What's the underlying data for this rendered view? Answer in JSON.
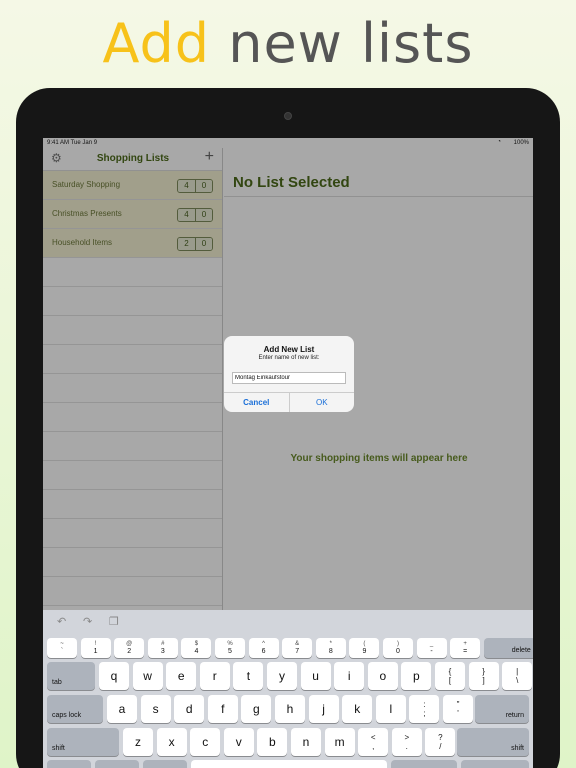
{
  "headline": {
    "accent": "Add",
    "rest": "new lists"
  },
  "status_bar": {
    "time": "9:41 AM   Tue Jan 9",
    "battery": "100%"
  },
  "sidebar": {
    "title": "Shopping Lists",
    "lists": [
      {
        "name": "Saturday Shopping",
        "count_a": "4",
        "count_b": "0"
      },
      {
        "name": "Christmas Presents",
        "count_a": "4",
        "count_b": "0"
      },
      {
        "name": "Household Items",
        "count_a": "2",
        "count_b": "0"
      }
    ]
  },
  "detail": {
    "title": "No List Selected",
    "placeholder": "Your shopping items will appear here"
  },
  "dialog": {
    "title": "Add New List",
    "message": "Enter name of new list:",
    "input_value": "Montag Einkaufstour",
    "cancel_label": "Cancel",
    "ok_label": "OK"
  },
  "keyboard": {
    "number_row": [
      {
        "top": "~",
        "bot": "`"
      },
      {
        "top": "!",
        "bot": "1"
      },
      {
        "top": "@",
        "bot": "2"
      },
      {
        "top": "#",
        "bot": "3"
      },
      {
        "top": "$",
        "bot": "4"
      },
      {
        "top": "%",
        "bot": "5"
      },
      {
        "top": "^",
        "bot": "6"
      },
      {
        "top": "&",
        "bot": "7"
      },
      {
        "top": "*",
        "bot": "8"
      },
      {
        "top": "(",
        "bot": "9"
      },
      {
        "top": ")",
        "bot": "0"
      },
      {
        "top": "_",
        "bot": "-"
      },
      {
        "top": "+",
        "bot": "="
      }
    ],
    "delete": "delete",
    "tab": "tab",
    "row1": [
      "q",
      "w",
      "e",
      "r",
      "t",
      "y",
      "u",
      "i",
      "o",
      "p"
    ],
    "row1_pairs": [
      {
        "top": "{",
        "bot": "["
      },
      {
        "top": "}",
        "bot": "]"
      },
      {
        "top": "|",
        "bot": "\\"
      }
    ],
    "caps": "caps lock",
    "row2": [
      "a",
      "s",
      "d",
      "f",
      "g",
      "h",
      "j",
      "k",
      "l"
    ],
    "row2_pairs": [
      {
        "top": ":",
        "bot": ";"
      },
      {
        "top": "\"",
        "bot": "'"
      }
    ],
    "return": "return",
    "shift": "shift",
    "row3": [
      "z",
      "x",
      "c",
      "v",
      "b",
      "n",
      "m"
    ],
    "row3_pairs": [
      {
        "top": "<",
        "bot": ","
      },
      {
        "top": ">",
        "bot": "."
      },
      {
        "top": "?",
        "bot": "/"
      }
    ]
  }
}
